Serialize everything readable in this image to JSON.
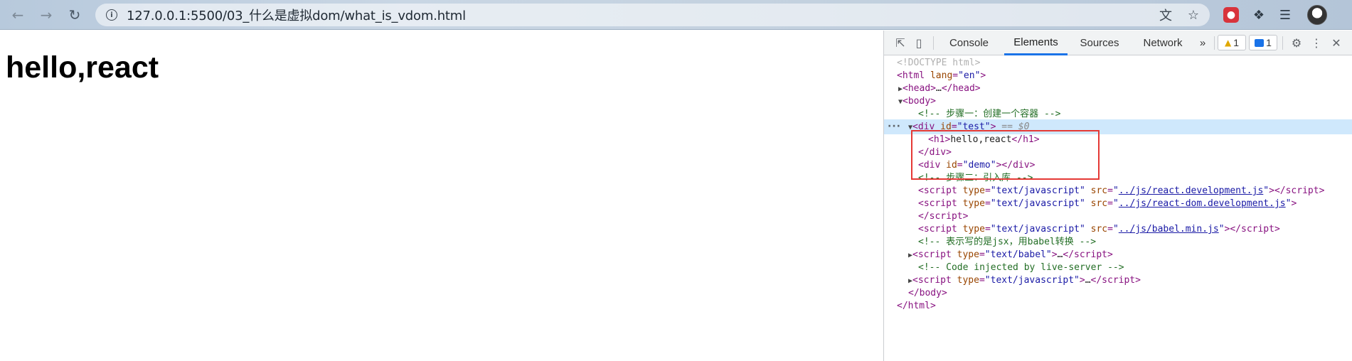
{
  "browser": {
    "url": "127.0.0.1:5500/03_什么是虚拟dom/what_is_vdom.html",
    "nav_icons": [
      "back-arrow-icon",
      "forward-arrow-icon",
      "reload-icon"
    ]
  },
  "page": {
    "heading": "hello,react"
  },
  "devtools": {
    "tabs": [
      "Console",
      "Elements",
      "Sources",
      "Network"
    ],
    "active_tab": "Elements",
    "more_tabs": "»",
    "warnings_count": "1",
    "messages_count": "1",
    "selected_suffix": "== $0",
    "dom": {
      "doctype": "<!DOCTYPE html>",
      "html_open": "html",
      "lang_attr": "lang",
      "lang_val": "\"en\"",
      "head": "head",
      "head_ellipsis": "…",
      "body": "body",
      "comment1": "<!-- 步骤一：创建一个容器 -->",
      "div": "div",
      "id_attr": "id",
      "test_val": "\"test\"",
      "h1": "h1",
      "h1_text": "hello,react",
      "demo_val": "\"demo\"",
      "comment2": "<!-- 步骤二：引入库 -->",
      "script": "script",
      "type_attr": "type",
      "src_attr": "src",
      "js_type": "\"text/javascript\"",
      "src1": "../js/react.development.js",
      "src2": "../js/react-dom.development.js",
      "src3": "../js/babel.min.js",
      "comment3": "<!-- 表示写的是jsx，用babel转换 -->",
      "babel_type": "\"text/babel\"",
      "comment4": "<!-- Code injected by live-server -->",
      "ellipsis": "…"
    }
  }
}
